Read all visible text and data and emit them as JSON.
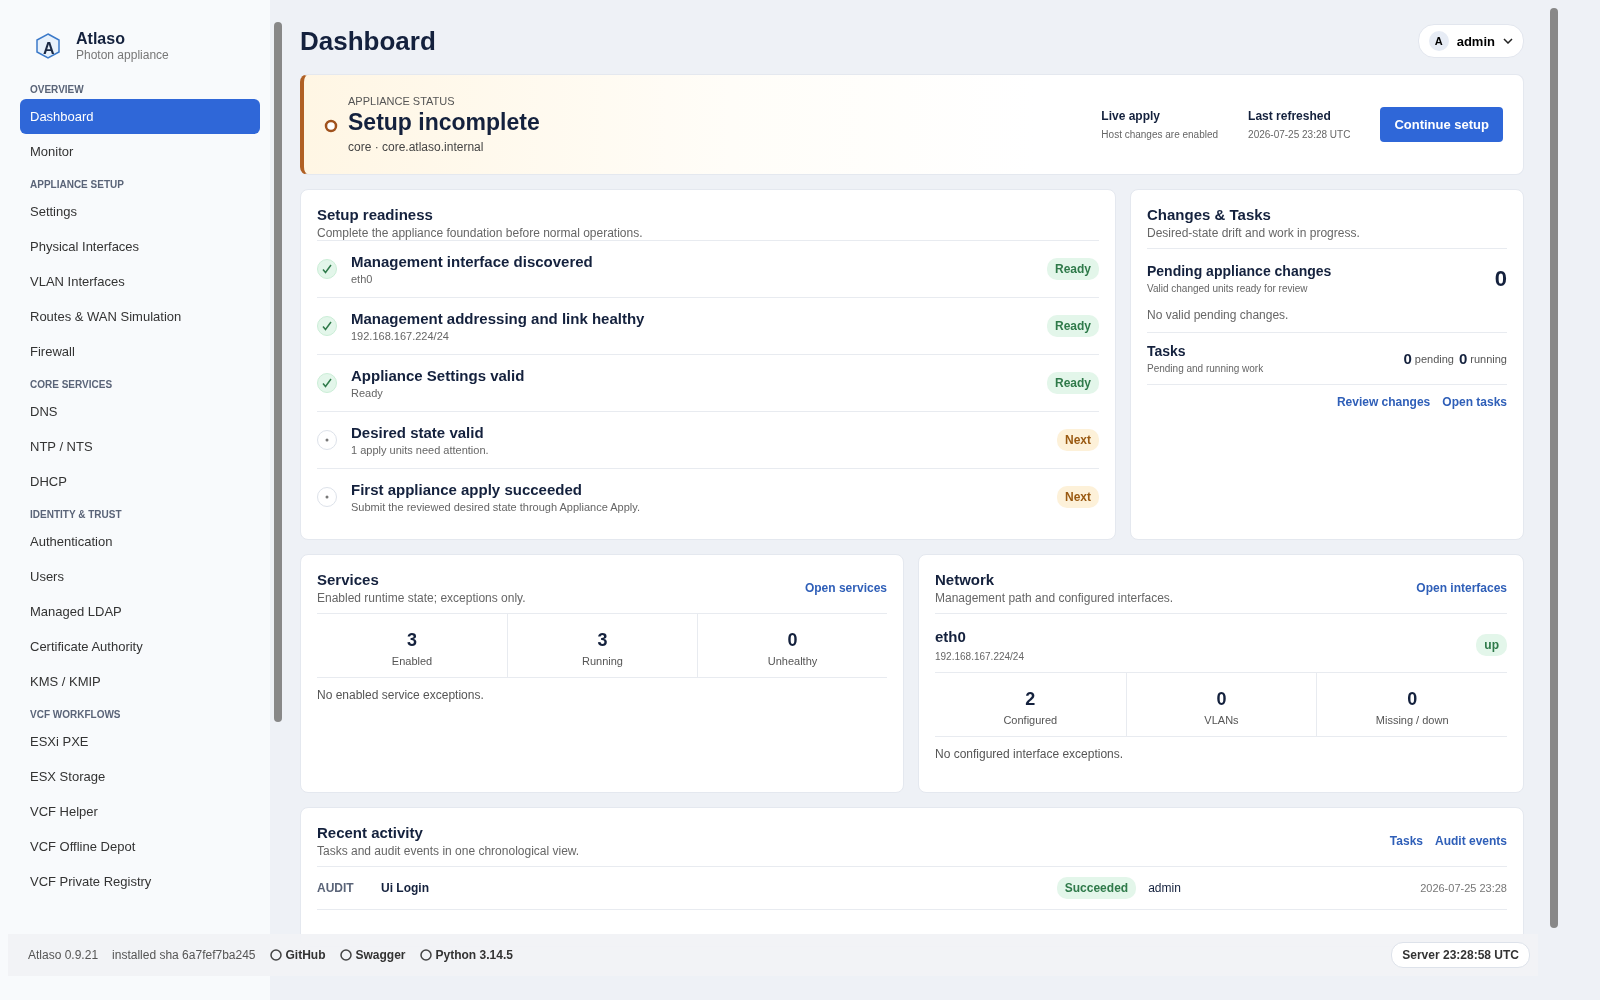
{
  "brand": {
    "name": "Atlaso",
    "subtitle": "Photon appliance",
    "logo_letter": "A"
  },
  "sidebar": {
    "groups": [
      {
        "heading": "OVERVIEW",
        "items": [
          {
            "label": "Dashboard",
            "selected": true
          },
          {
            "label": "Monitor",
            "selected": false
          }
        ]
      },
      {
        "heading": "APPLIANCE SETUP",
        "items": [
          {
            "label": "Settings",
            "selected": false
          },
          {
            "label": "Physical Interfaces",
            "selected": false
          },
          {
            "label": "VLAN Interfaces",
            "selected": false
          },
          {
            "label": "Routes & WAN Simulation",
            "selected": false
          },
          {
            "label": "Firewall",
            "selected": false
          }
        ]
      },
      {
        "heading": "CORE SERVICES",
        "items": [
          {
            "label": "DNS",
            "selected": false
          },
          {
            "label": "NTP / NTS",
            "selected": false
          },
          {
            "label": "DHCP",
            "selected": false
          }
        ]
      },
      {
        "heading": "IDENTITY & TRUST",
        "items": [
          {
            "label": "Authentication",
            "selected": false
          },
          {
            "label": "Users",
            "selected": false
          },
          {
            "label": "Managed LDAP",
            "selected": false
          },
          {
            "label": "Certificate Authority",
            "selected": false
          },
          {
            "label": "KMS / KMIP",
            "selected": false
          }
        ]
      },
      {
        "heading": "VCF WORKFLOWS",
        "items": [
          {
            "label": "ESXi PXE",
            "selected": false
          },
          {
            "label": "ESX Storage",
            "selected": false
          },
          {
            "label": "VCF Helper",
            "selected": false
          },
          {
            "label": "VCF Offline Depot",
            "selected": false
          },
          {
            "label": "VCF Private Registry",
            "selected": false
          }
        ]
      }
    ]
  },
  "page_title": "Dashboard",
  "user": {
    "initial": "A",
    "name": "admin"
  },
  "status": {
    "eyebrow": "APPLIANCE STATUS",
    "title": "Setup incomplete",
    "subtitle": "core · core.atlaso.internal",
    "facts": [
      {
        "label": "Live apply",
        "value": "Host changes are enabled"
      },
      {
        "label": "Last refreshed",
        "value": "2026-07-25 23:28 UTC"
      }
    ],
    "button": "Continue setup"
  },
  "readiness": {
    "title": "Setup readiness",
    "subtitle": "Complete the appliance foundation before normal operations.",
    "items": [
      {
        "title": "Management interface discovered",
        "detail": "eth0",
        "done": true,
        "badge": "Ready"
      },
      {
        "title": "Management addressing and link healthy",
        "detail": "192.168.167.224/24",
        "done": true,
        "badge": "Ready"
      },
      {
        "title": "Appliance Settings valid",
        "detail": "Ready",
        "done": true,
        "badge": "Ready"
      },
      {
        "title": "Desired state valid",
        "detail": "1 apply units need attention.",
        "done": false,
        "badge": "Next"
      },
      {
        "title": "First appliance apply succeeded",
        "detail": "Submit the reviewed desired state through Appliance Apply.",
        "done": false,
        "badge": "Next"
      }
    ]
  },
  "changes": {
    "title": "Changes & Tasks",
    "subtitle": "Desired-state drift and work in progress.",
    "pending": {
      "title": "Pending appliance changes",
      "subtitle": "Valid changed units ready for review",
      "count": "0",
      "note": "No valid pending changes."
    },
    "tasks": {
      "title": "Tasks",
      "subtitle": "Pending and running work",
      "pending_count": "0",
      "pending_label": "pending",
      "running_count": "0",
      "running_label": "running"
    },
    "links": [
      "Review changes",
      "Open tasks"
    ]
  },
  "services": {
    "title": "Services",
    "subtitle": "Enabled runtime state; exceptions only.",
    "link": "Open services",
    "stats": [
      {
        "value": "3",
        "label": "Enabled"
      },
      {
        "value": "3",
        "label": "Running"
      },
      {
        "value": "0",
        "label": "Unhealthy"
      }
    ],
    "note": "No enabled service exceptions."
  },
  "network": {
    "title": "Network",
    "subtitle": "Management path and configured interfaces.",
    "link": "Open interfaces",
    "interface": {
      "name": "eth0",
      "address": "192.168.167.224/24",
      "state": "up"
    },
    "stats": [
      {
        "value": "2",
        "label": "Configured"
      },
      {
        "value": "0",
        "label": "VLANs"
      },
      {
        "value": "0",
        "label": "Missing / down"
      }
    ],
    "note": "No configured interface exceptions."
  },
  "activity": {
    "title": "Recent activity",
    "subtitle": "Tasks and audit events in one chronological view.",
    "links": [
      "Tasks",
      "Audit events"
    ],
    "rows": [
      {
        "kind": "AUDIT",
        "event": "Ui Login",
        "result": "Succeeded",
        "actor": "admin",
        "time": "2026-07-25 23:28"
      }
    ]
  },
  "footer": {
    "version": "Atlaso 0.9.21",
    "sha": "installed sha 6a7fef7ba245",
    "links": [
      "GitHub",
      "Swagger",
      "Python 3.14.5"
    ],
    "server": "Server 23:28:58 UTC"
  }
}
